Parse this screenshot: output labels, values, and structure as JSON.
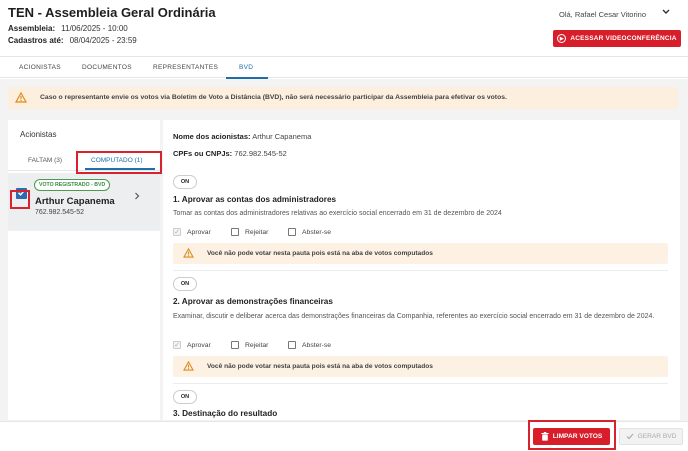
{
  "header": {
    "title": "TEN - Assembleia Geral Ordinária",
    "assembleia_label": "Assembleia:",
    "assembleia_value": "11/06/2025 - 10:00",
    "cadastros_label": "Cadastros até:",
    "cadastros_value": "08/04/2025 - 23:59",
    "user_greeting": "Olá, Rafael Cesar Vitorino",
    "video_button": "ACESSAR VIDEOCONFERÊNCIA"
  },
  "tabs": [
    {
      "label": "ACIONISTAS"
    },
    {
      "label": "DOCUMENTOS"
    },
    {
      "label": "REPRESENTANTES"
    },
    {
      "label": "BVD",
      "active": true
    }
  ],
  "alert": {
    "text": "Caso o representante envie os votos via Boletim de Voto a Distância (BVD), não será necessário participar da Assembleia para efetivar os votos."
  },
  "left_panel": {
    "title": "Acionistas",
    "tab_missing": "FALTAM (3)",
    "tab_computed": "COMPUTADO (1)",
    "item": {
      "badge": "VOTO REGISTRADO - BVD",
      "name": "Arthur Capanema",
      "cpf": "762.982.545-52",
      "checked": true
    }
  },
  "main": {
    "names_label": "Nome dos acionistas:",
    "names_value": "Arthur Capanema",
    "cpf_label": "CPFs ou CNPJs:",
    "cpf_value": "762.982.545-52",
    "toggle_label": "ON",
    "warning": "Você não pode votar nesta pauta pois está na aba de votos computados",
    "options": [
      "Aprovar",
      "Rejeitar",
      "Abster-se"
    ],
    "items": [
      {
        "title": "1. Aprovar as contas dos administradores",
        "description": "Tomar as contas dos administradores relativas ao exercício social encerrado em 31 de dezembro de 2024"
      },
      {
        "title": "2. Aprovar as demonstrações financeiras",
        "description": "Examinar, discutir e deliberar acerca das demonstrações financeiras da Companhia, referentes ao exercício social encerrado em 31 de dezembro de 2024."
      },
      {
        "title": "3. Destinação do resultado",
        "description": ""
      }
    ]
  },
  "footer": {
    "clear_button": "LIMPAR VOTOS",
    "generate_button": "GERAR BVD"
  },
  "colors": {
    "accent_red": "#d81e2a",
    "accent_blue": "#1d6fa5",
    "badge_green": "#3b8a40",
    "warning_bg": "#fcefde"
  }
}
